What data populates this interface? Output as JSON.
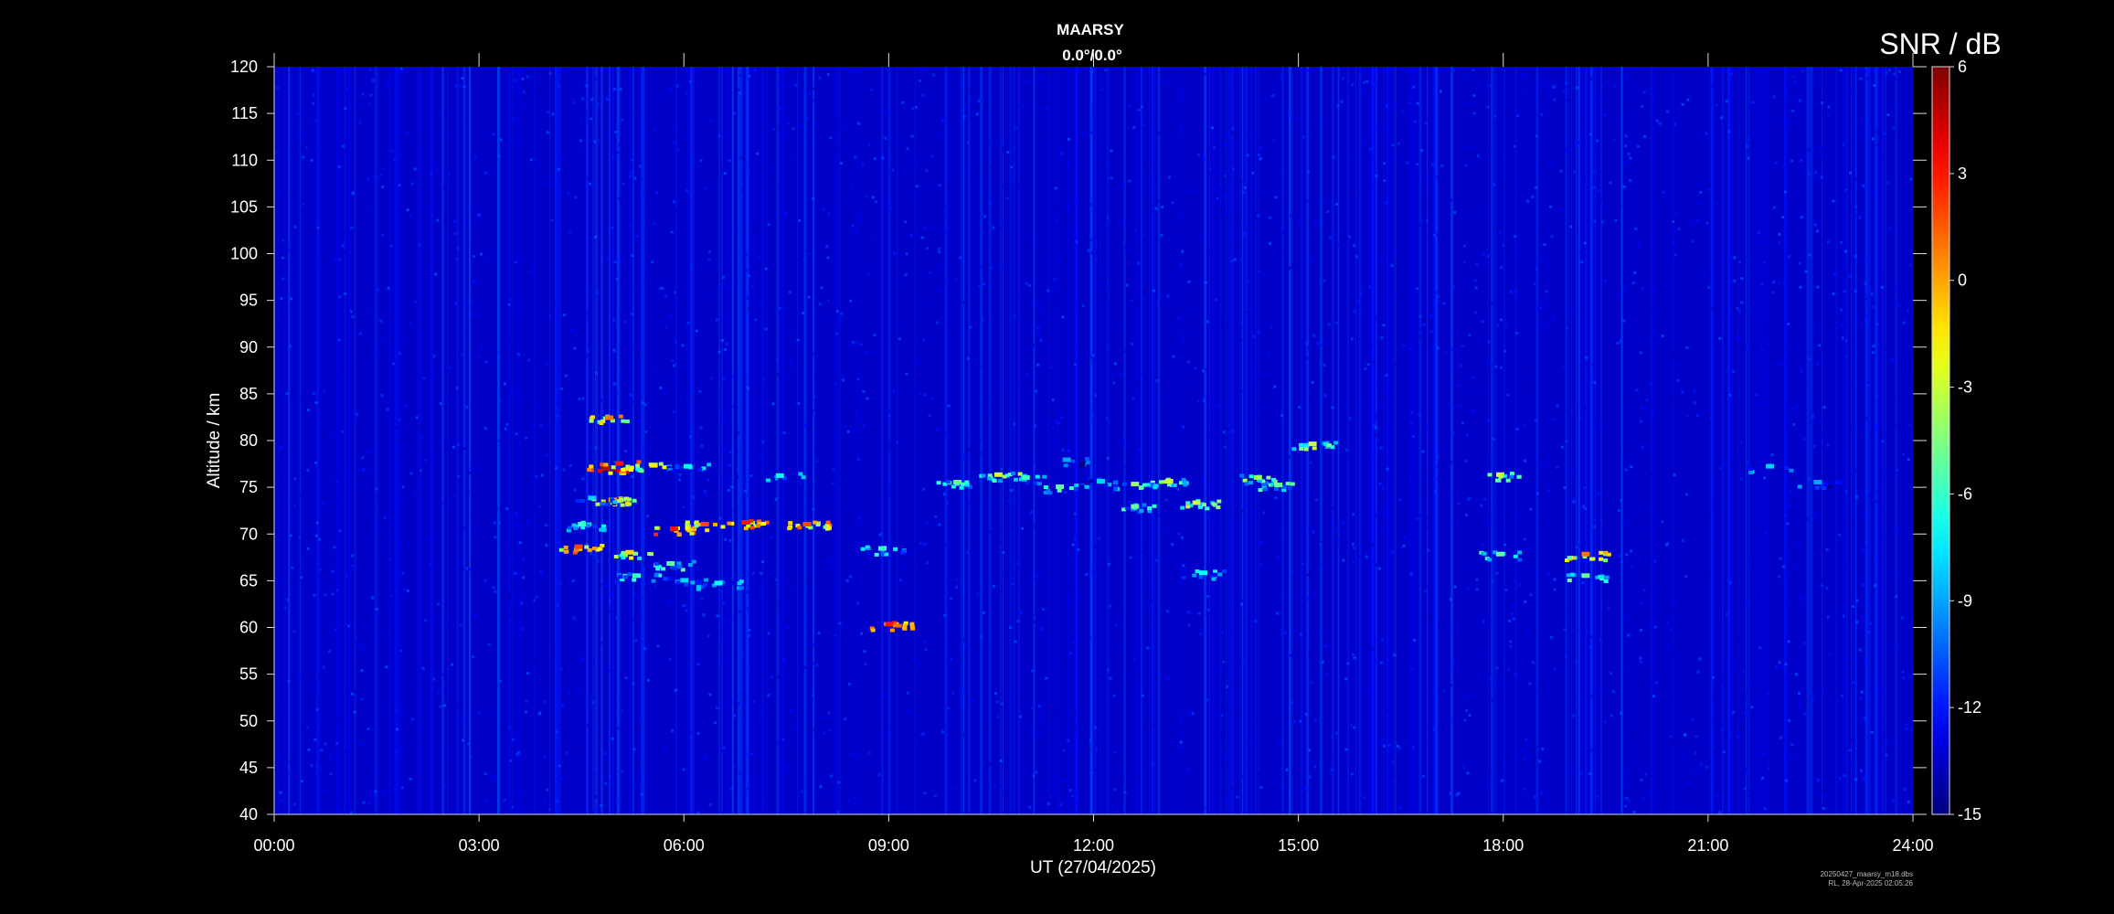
{
  "chart_data": {
    "type": "heatmap",
    "title": "MAARSY",
    "subtitle": "0.0°/0.0°",
    "xlabel": "UT (27/04/2025)",
    "ylabel": "Altitude / km",
    "xlim": [
      0,
      24
    ],
    "ylim": [
      40,
      120
    ],
    "x_ticks": [
      "00:00",
      "03:00",
      "06:00",
      "09:00",
      "12:00",
      "15:00",
      "18:00",
      "21:00",
      "24:00"
    ],
    "x_tick_values": [
      0,
      3,
      6,
      9,
      12,
      15,
      18,
      21,
      24
    ],
    "y_ticks": [
      40,
      45,
      50,
      55,
      60,
      65,
      70,
      75,
      80,
      85,
      90,
      95,
      100,
      105,
      110,
      115,
      120
    ],
    "colorbar": {
      "label": "SNR / dB",
      "range": [
        -15,
        6
      ],
      "ticks": [
        6,
        3,
        0,
        -3,
        -6,
        -9,
        -12,
        -15
      ],
      "colormap": "jet"
    },
    "background_snr": -13.5,
    "echo_regions": [
      {
        "t": 4.85,
        "alt": 77.0,
        "snr": 4.5
      },
      {
        "t": 5.05,
        "alt": 77.5,
        "snr": 3.0
      },
      {
        "t": 5.55,
        "alt": 77.3,
        "snr": -1.5
      },
      {
        "t": 6.05,
        "alt": 77.2,
        "snr": -7.0
      },
      {
        "t": 4.95,
        "alt": 73.6,
        "snr": 0.0
      },
      {
        "t": 4.65,
        "alt": 73.8,
        "snr": -8.0
      },
      {
        "t": 4.5,
        "alt": 71.0,
        "snr": -6.0
      },
      {
        "t": 5.85,
        "alt": 70.5,
        "snr": 3.0
      },
      {
        "t": 6.3,
        "alt": 71.0,
        "snr": 2.0
      },
      {
        "t": 6.9,
        "alt": 71.2,
        "snr": 3.0
      },
      {
        "t": 4.45,
        "alt": 68.6,
        "snr": 2.0
      },
      {
        "t": 5.2,
        "alt": 68.0,
        "snr": -1.0
      },
      {
        "t": 5.8,
        "alt": 66.8,
        "snr": -5.0
      },
      {
        "t": 5.3,
        "alt": 65.5,
        "snr": -6.0
      },
      {
        "t": 6.0,
        "alt": 65.0,
        "snr": -8.0
      },
      {
        "t": 6.5,
        "alt": 64.7,
        "snr": -7.0
      },
      {
        "t": 7.4,
        "alt": 76.2,
        "snr": -7.0
      },
      {
        "t": 7.8,
        "alt": 71.0,
        "snr": 2.0
      },
      {
        "t": 8.9,
        "alt": 68.4,
        "snr": -6.0
      },
      {
        "t": 9.0,
        "alt": 60.3,
        "snr": 3.0
      },
      {
        "t": 4.9,
        "alt": 82.4,
        "snr": 1.0
      },
      {
        "t": 10.0,
        "alt": 75.5,
        "snr": -5.0
      },
      {
        "t": 10.6,
        "alt": 76.3,
        "snr": -3.0
      },
      {
        "t": 11.0,
        "alt": 76.0,
        "snr": -6.0
      },
      {
        "t": 11.5,
        "alt": 75.0,
        "snr": -5.0
      },
      {
        "t": 12.1,
        "alt": 75.6,
        "snr": -8.0
      },
      {
        "t": 12.6,
        "alt": 75.3,
        "snr": -4.0
      },
      {
        "t": 13.1,
        "alt": 75.6,
        "snr": -3.0
      },
      {
        "t": 12.6,
        "alt": 72.9,
        "snr": -5.0
      },
      {
        "t": 13.5,
        "alt": 73.3,
        "snr": -3.0
      },
      {
        "t": 14.4,
        "alt": 76.0,
        "snr": -4.0
      },
      {
        "t": 14.7,
        "alt": 75.2,
        "snr": -5.0
      },
      {
        "t": 15.2,
        "alt": 79.6,
        "snr": -3.0
      },
      {
        "t": 13.6,
        "alt": 65.8,
        "snr": -7.0
      },
      {
        "t": 11.6,
        "alt": 77.9,
        "snr": -9.0
      },
      {
        "t": 17.95,
        "alt": 76.3,
        "snr": -3.0
      },
      {
        "t": 17.95,
        "alt": 67.8,
        "snr": -5.0
      },
      {
        "t": 19.2,
        "alt": 67.8,
        "snr": 1.0
      },
      {
        "t": 19.2,
        "alt": 65.5,
        "snr": -5.0
      },
      {
        "t": 21.9,
        "alt": 77.2,
        "snr": -8.0
      },
      {
        "t": 22.6,
        "alt": 75.5,
        "snr": -9.0
      }
    ]
  },
  "footer": {
    "file": "20250427_maarsy_m18.dbs",
    "created": "RL, 28-Apr-2025 02:05:26"
  }
}
